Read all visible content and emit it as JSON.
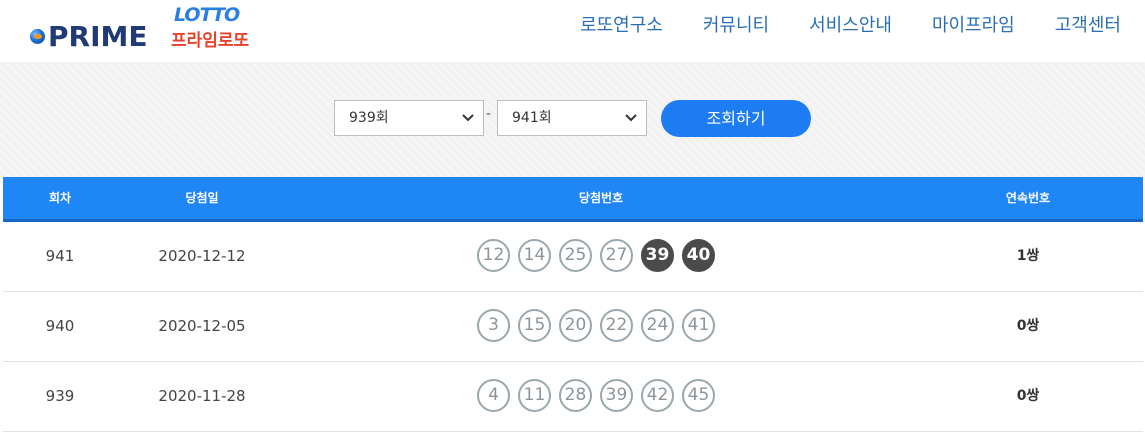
{
  "brand": {
    "prime": "PRIME",
    "lotto": "LOTTO",
    "korean": "프라임로또"
  },
  "nav": [
    {
      "label": "로또연구소"
    },
    {
      "label": "커뮤니티"
    },
    {
      "label": "서비스안내"
    },
    {
      "label": "마이프라임"
    },
    {
      "label": "고객센터"
    }
  ],
  "filter": {
    "from": "939회",
    "separator": "-",
    "to": "941회",
    "search_label": "조회하기"
  },
  "table": {
    "headers": {
      "round": "회차",
      "date": "당첨일",
      "numbers": "당첨번호",
      "streak": "연속번호"
    },
    "rows": [
      {
        "round": "941",
        "date": "2020-12-12",
        "balls": [
          {
            "n": "12",
            "hit": false
          },
          {
            "n": "14",
            "hit": false
          },
          {
            "n": "25",
            "hit": false
          },
          {
            "n": "27",
            "hit": false
          },
          {
            "n": "39",
            "hit": true
          },
          {
            "n": "40",
            "hit": true
          }
        ],
        "streak": "1쌍"
      },
      {
        "round": "940",
        "date": "2020-12-05",
        "balls": [
          {
            "n": "3",
            "hit": false
          },
          {
            "n": "15",
            "hit": false
          },
          {
            "n": "20",
            "hit": false
          },
          {
            "n": "22",
            "hit": false
          },
          {
            "n": "24",
            "hit": false
          },
          {
            "n": "41",
            "hit": false
          }
        ],
        "streak": "0쌍"
      },
      {
        "round": "939",
        "date": "2020-11-28",
        "balls": [
          {
            "n": "4",
            "hit": false
          },
          {
            "n": "11",
            "hit": false
          },
          {
            "n": "28",
            "hit": false
          },
          {
            "n": "39",
            "hit": false
          },
          {
            "n": "42",
            "hit": false
          },
          {
            "n": "45",
            "hit": false
          }
        ],
        "streak": "0쌍"
      }
    ]
  },
  "colors": {
    "accent": "#1e86f5",
    "button": "#1e7cf2",
    "nav_text": "#2a6fb5",
    "hit_ball": "#4b4b4b"
  }
}
